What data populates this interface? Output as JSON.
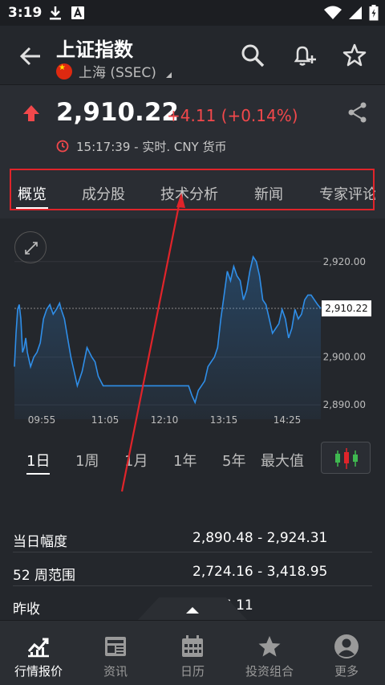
{
  "status_bar": {
    "time": "3:19"
  },
  "header": {
    "title": "上证指数",
    "exchange": "上海 (SSEC)"
  },
  "quote": {
    "price": "2,910.22",
    "change": "+4.11 (+0.14%)",
    "timestamp": "15:17:39 - 实时.  CNY 货币"
  },
  "tabs": [
    {
      "label": "概览"
    },
    {
      "label": "成分股"
    },
    {
      "label": "技术分析"
    },
    {
      "label": "新闻"
    },
    {
      "label": "专家评论"
    }
  ],
  "chart_data": {
    "type": "line",
    "x_ticks": [
      "09:55",
      "11:05",
      "12:10",
      "13:15",
      "14:25"
    ],
    "y_ticks": [
      "2,920.00",
      "2,900.00",
      "2,890.00"
    ],
    "ylim": [
      2887,
      2924
    ],
    "last_price_label": "2,910.22",
    "reference_level": 2910.2,
    "series": [
      {
        "color": "#2f8ee8",
        "x": [
          0,
          2,
          4,
          6,
          8,
          10,
          12,
          14,
          16,
          20,
          24,
          28,
          32,
          36,
          40,
          44,
          48,
          52,
          56,
          58,
          62,
          66,
          70,
          74,
          78,
          84,
          90,
          96,
          100,
          104,
          110,
          116,
          122,
          130,
          140,
          150,
          160,
          170,
          180,
          190,
          200,
          210,
          216,
          220,
          224,
          228,
          232,
          236,
          240,
          244,
          248,
          252,
          256,
          260,
          264,
          268,
          272,
          276,
          280,
          284,
          288,
          292,
          296,
          300,
          304,
          308,
          312,
          316,
          320,
          324,
          328,
          332,
          336,
          340,
          344,
          348,
          352,
          356,
          360,
          364,
          368,
          372,
          376,
          380
        ],
        "y": [
          2898,
          2905,
          2910,
          2911,
          2908,
          2901,
          2902,
          2904,
          2901,
          2898,
          2900,
          2901,
          2903,
          2908,
          2910,
          2911,
          2909,
          2910,
          2911.3,
          2910,
          2908,
          2904,
          2900,
          2897,
          2894,
          2897,
          2902,
          2900,
          2899,
          2896,
          2894,
          2894,
          2894,
          2894,
          2894,
          2894,
          2894,
          2894,
          2894,
          2894,
          2894,
          2894,
          2894,
          2892,
          2890.5,
          2893,
          2894,
          2895,
          2898,
          2899,
          2900,
          2902,
          2908,
          2913,
          2918,
          2916,
          2919,
          2917,
          2916,
          2912,
          2914,
          2918,
          2921,
          2920,
          2917,
          2912,
          2911,
          2908,
          2905,
          2906,
          2907,
          2910,
          2908,
          2904,
          2906,
          2910,
          2908,
          2909,
          2912,
          2913,
          2913,
          2912,
          2911,
          2910.2
        ]
      }
    ]
  },
  "ranges": [
    {
      "label": "1日"
    },
    {
      "label": "1周"
    },
    {
      "label": "1月"
    },
    {
      "label": "1年"
    },
    {
      "label": "5年"
    },
    {
      "label": "最大值"
    }
  ],
  "stats": [
    {
      "label": "当日幅度",
      "value": "2,890.48 - 2,924.31"
    },
    {
      "label": "52 周范围",
      "value": "2,724.16 - 3,418.95"
    },
    {
      "label": "昨收",
      "value": "2,906.11"
    }
  ],
  "nav": [
    {
      "label": "行情报价",
      "icon": "chart-icon"
    },
    {
      "label": "资讯",
      "icon": "news-icon"
    },
    {
      "label": "日历",
      "icon": "calendar-icon"
    },
    {
      "label": "投资组合",
      "icon": "star-icon"
    },
    {
      "label": "更多",
      "icon": "user-icon"
    }
  ],
  "colors": {
    "accent_red": "#e0242a",
    "up_red": "#f2484b",
    "line_blue": "#2f8ee8",
    "background": "#24272c"
  }
}
